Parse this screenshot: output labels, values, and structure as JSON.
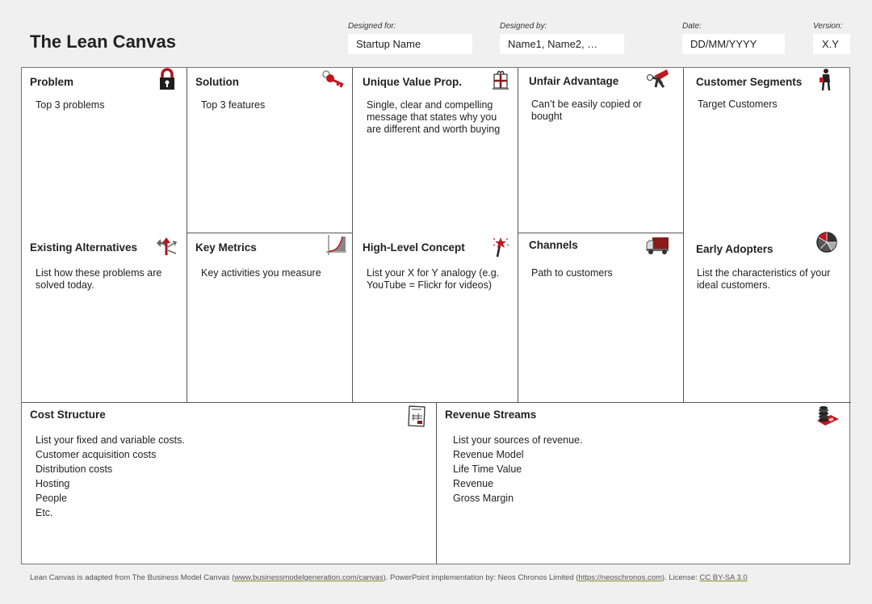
{
  "header": {
    "title": "The Lean Canvas",
    "designed_for": {
      "label": "Designed for:",
      "value": "Startup Name"
    },
    "designed_by": {
      "label": "Designed by:",
      "value": "Name1, Name2, …"
    },
    "date": {
      "label": "Date:",
      "value": "DD/MM/YYYY"
    },
    "version": {
      "label": "Version:",
      "value": "X.Y"
    }
  },
  "blocks": {
    "problem": {
      "title": "Problem",
      "text": "Top 3 problems",
      "icon": "padlock-icon"
    },
    "solution": {
      "title": "Solution",
      "text": "Top 3 features",
      "icon": "key-icon"
    },
    "uvp": {
      "title": "Unique Value Prop.",
      "text": "Single, clear and compelling message that states why you are different and worth buying",
      "icon": "gift-box-icon"
    },
    "unfair": {
      "title": "Unfair Advantage",
      "text": "Can’t be easily copied or bought",
      "icon": "superhero-icon"
    },
    "segments": {
      "title": "Customer Segments",
      "text": "Target Customers",
      "icon": "businessman-icon"
    },
    "alternatives": {
      "title": "Existing Alternatives",
      "text": "List how these problems are solved today.",
      "icon": "diverging-arrows-icon"
    },
    "metrics": {
      "title": "Key Metrics",
      "text": "Key activities you measure",
      "icon": "growth-chart-icon"
    },
    "concept": {
      "title": "High-Level Concept",
      "text": "List your X for Y analogy (e.g. YouTube = Flickr for videos)",
      "icon": "magic-wand-icon"
    },
    "channels": {
      "title": "Channels",
      "text": "Path to customers",
      "icon": "delivery-truck-icon"
    },
    "adopters": {
      "title": "Early Adopters",
      "text": "List the characteristics of your ideal customers.",
      "icon": "pie-chart-icon"
    },
    "cost": {
      "title": "Cost Structure",
      "items": [
        "List your fixed and variable costs.",
        "Customer acquisition costs",
        "Distribution costs",
        "Hosting",
        "People",
        "Etc."
      ],
      "icon": "receipt-icon"
    },
    "revenue": {
      "title": "Revenue Streams",
      "items": [
        "List your sources of revenue.",
        "Revenue Model",
        "Life Time Value",
        "Revenue",
        "Gross Margin"
      ],
      "icon": "coins-icon"
    }
  },
  "footer": {
    "t1": "Lean Canvas is adapted from The Business Model Canvas (",
    "link1": "www.businessmodelgeneration.com/canvas",
    "t2": "). PowerPoint implementation by: Neos Chronos Limited (",
    "link2": "https://neoschronos.com",
    "t3": "). License: ",
    "link3": "CC BY-SA 3.0"
  },
  "colors": {
    "accent_red": "#c0171f",
    "icon_dark": "#2a2a2a",
    "border": "#555555",
    "background": "#f0f0f0"
  }
}
